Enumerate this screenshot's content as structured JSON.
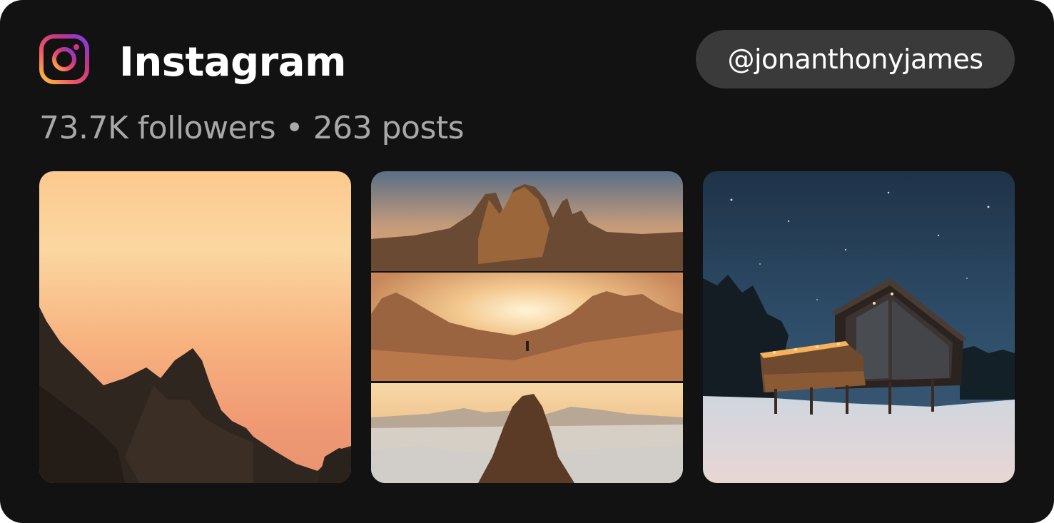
{
  "header": {
    "app_name": "Instagram",
    "logo_icon": "instagram-logo-icon",
    "handle": "@jonanthonyjames"
  },
  "stats": {
    "followers": "73.7K followers",
    "separator": "•",
    "posts": "263 posts"
  },
  "colors": {
    "background": "#121212",
    "title_text": "#ffffff",
    "secondary_text": "#a8a8a8",
    "pill_background": "#3a3a3a"
  },
  "photos": [
    {
      "name": "photo-sunset-rocky-coast"
    },
    {
      "name": "photo-dolomites-collage"
    },
    {
      "name": "photo-cabin-night-snow"
    }
  ]
}
